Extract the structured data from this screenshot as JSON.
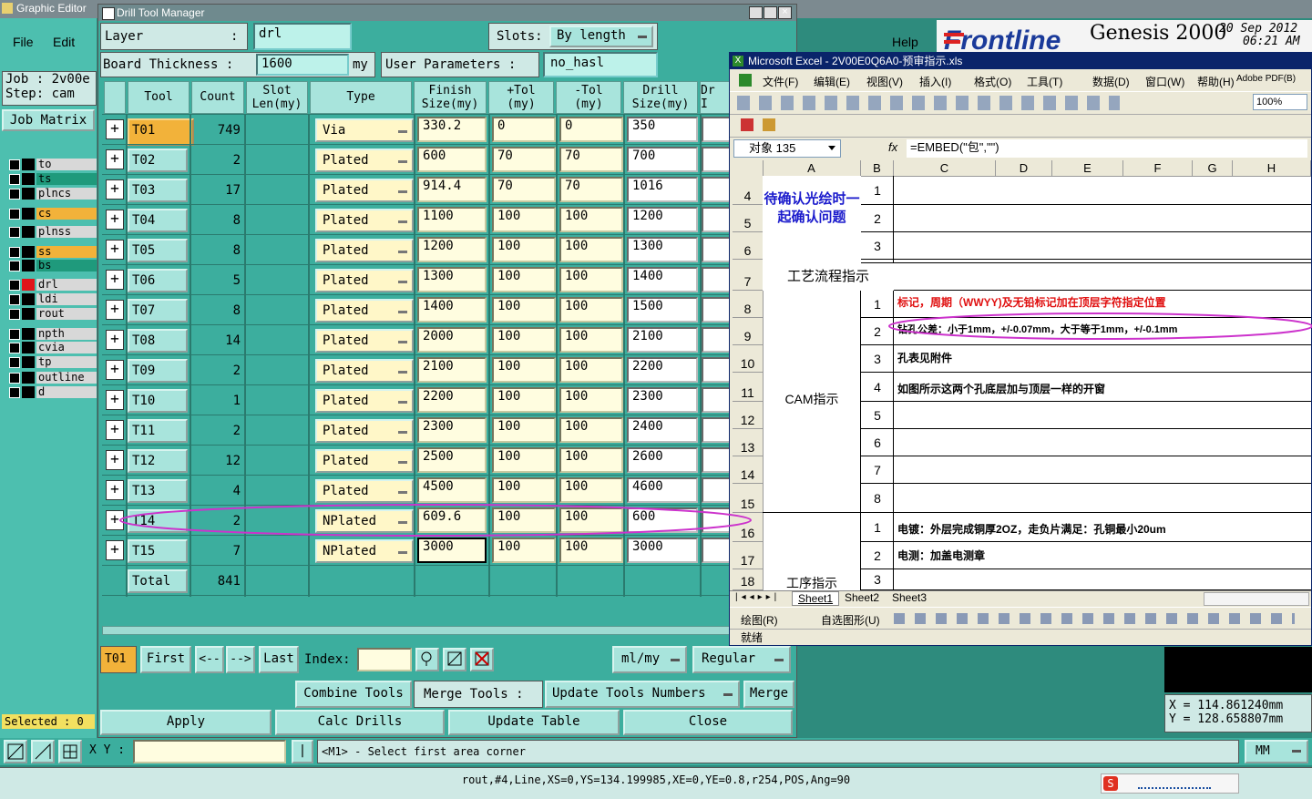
{
  "genesis": {
    "title": "Graphic Editor",
    "menu": {
      "file": "File",
      "edit": "Edit",
      "help": "Help"
    },
    "job_label": "Job : 2v00e",
    "step_label": "Step: cam",
    "job_matrix": "Job Matrix",
    "layers": [
      "to",
      "ts",
      "plncs",
      "cs",
      "plnss",
      "ss",
      "bs",
      "drl",
      "ldi",
      "rout",
      "npth",
      "cvia",
      "tp",
      "outline",
      "d"
    ],
    "layer_colors": {
      "ts": "#1f9a7c",
      "cs": "#f2b23a",
      "ss": "#f2b23a",
      "bs": "#1f9a7c",
      "default": "#d8d8d8"
    },
    "selected": "Selected : 0",
    "brand": "Frontline",
    "product": "Genesis 2000",
    "date": "20 Sep 2012",
    "time": "06:21 AM",
    "coords": {
      "x": "X  =  114.861240mm",
      "y": "Y  =  128.658807mm"
    },
    "xy_label": "X Y :",
    "prompt": "<M1> - Select first area corner",
    "units": "MM",
    "status_line": "rout,#4,Line,XS=0,YS=134.199985,XE=0,YE=0.8,r254,POS,Ang=90"
  },
  "dtm": {
    "title": "Drill Tool Manager",
    "layer_label": "Layer",
    "layer_colon": ":",
    "layer_value": "drl",
    "slots_label": "Slots:",
    "slots_value": "By length",
    "thickness_label": "Board Thickness :",
    "thickness_value": "1600",
    "thickness_unit": "my",
    "user_params_label": "User Parameters :",
    "user_params_value": "no_hasl",
    "headers": {
      "tool": "Tool",
      "count": "Count",
      "slot": "Slot\nLen(my)",
      "type": "Type",
      "finish": "Finish\nSize(my)",
      "ptol": "+Tol\n(my)",
      "mtol": "-Tol\n(my)",
      "drill": "Drill\nSize(my)",
      "dr_cut": "Dr\nI"
    },
    "rows": [
      {
        "tool": "T01",
        "count": "749",
        "type": "Via",
        "finish": "330.2",
        "ptol": "0",
        "mtol": "0",
        "drill": "350"
      },
      {
        "tool": "T02",
        "count": "2",
        "type": "Plated",
        "finish": "600",
        "ptol": "70",
        "mtol": "70",
        "drill": "700"
      },
      {
        "tool": "T03",
        "count": "17",
        "type": "Plated",
        "finish": "914.4",
        "ptol": "70",
        "mtol": "70",
        "drill": "1016"
      },
      {
        "tool": "T04",
        "count": "8",
        "type": "Plated",
        "finish": "1100",
        "ptol": "100",
        "mtol": "100",
        "drill": "1200"
      },
      {
        "tool": "T05",
        "count": "8",
        "type": "Plated",
        "finish": "1200",
        "ptol": "100",
        "mtol": "100",
        "drill": "1300"
      },
      {
        "tool": "T06",
        "count": "5",
        "type": "Plated",
        "finish": "1300",
        "ptol": "100",
        "mtol": "100",
        "drill": "1400"
      },
      {
        "tool": "T07",
        "count": "8",
        "type": "Plated",
        "finish": "1400",
        "ptol": "100",
        "mtol": "100",
        "drill": "1500"
      },
      {
        "tool": "T08",
        "count": "14",
        "type": "Plated",
        "finish": "2000",
        "ptol": "100",
        "mtol": "100",
        "drill": "2100"
      },
      {
        "tool": "T09",
        "count": "2",
        "type": "Plated",
        "finish": "2100",
        "ptol": "100",
        "mtol": "100",
        "drill": "2200"
      },
      {
        "tool": "T10",
        "count": "1",
        "type": "Plated",
        "finish": "2200",
        "ptol": "100",
        "mtol": "100",
        "drill": "2300"
      },
      {
        "tool": "T11",
        "count": "2",
        "type": "Plated",
        "finish": "2300",
        "ptol": "100",
        "mtol": "100",
        "drill": "2400"
      },
      {
        "tool": "T12",
        "count": "12",
        "type": "Plated",
        "finish": "2500",
        "ptol": "100",
        "mtol": "100",
        "drill": "2600"
      },
      {
        "tool": "T13",
        "count": "4",
        "type": "Plated",
        "finish": "4500",
        "ptol": "100",
        "mtol": "100",
        "drill": "4600"
      },
      {
        "tool": "T14",
        "count": "2",
        "type": "NPlated",
        "finish": "609.6",
        "ptol": "100",
        "mtol": "100",
        "drill": "600"
      },
      {
        "tool": "T15",
        "count": "7",
        "type": "NPlated",
        "finish": "3000",
        "ptol": "100",
        "mtol": "100",
        "drill": "3000"
      }
    ],
    "total_label": "Total",
    "total_value": "841",
    "current_tool": "T01",
    "nav": {
      "first": "First",
      "prev": "<--",
      "next": "-->",
      "last": "Last",
      "index": "Index:"
    },
    "unit_select": "ml/my",
    "mode_select": "Regular",
    "combine": "Combine Tools",
    "merge_tools": "Merge Tools :",
    "update_numbers": "Update Tools Numbers",
    "merge": "Merge",
    "apply": "Apply",
    "calc": "Calc Drills",
    "update_table": "Update Table",
    "close": "Close"
  },
  "excel": {
    "title": "Microsoft Excel - 2V00E0Q6A0-预审指示.xls",
    "menu": [
      "文件(F)",
      "编辑(E)",
      "视图(V)",
      "插入(I)",
      "格式(O)",
      "工具(T)",
      "数据(D)",
      "窗口(W)",
      "帮助(H)",
      "Adobe PDF(B)"
    ],
    "zoom": "100%",
    "name_box": "对象 135",
    "fx": "fx",
    "formula": "=EMBED(\"包\",\"\")",
    "columns": [
      "A",
      "B",
      "C",
      "D",
      "E",
      "F",
      "G",
      "H"
    ],
    "rows": [
      "4",
      "5",
      "6",
      "7",
      "8",
      "9",
      "10",
      "11",
      "12",
      "13",
      "14",
      "15",
      "16",
      "17",
      "18"
    ],
    "cells": {
      "a4": "待确认光绘时一起确认问题",
      "b4": "1",
      "b5": "2",
      "b6": "3",
      "a7": "工艺流程指示",
      "b8": "1",
      "c8": "标记，周期（WWYY)及无铅标记加在顶层字符指定位置",
      "b9": "2",
      "c9": "钻孔公差：小于1mm，+/-0.07mm，大于等于1mm，+/-0.1mm",
      "b10": "3",
      "c10": "孔表见附件",
      "a11": "CAM指示",
      "b11": "4",
      "c11": "如图所示这两个孔底层加与顶层一样的开窗",
      "b12": "5",
      "b13": "6",
      "b14": "7",
      "b15": "8",
      "b16": "1",
      "c16": "电镀：外层完成铜厚2OZ，走负片满足：孔铜最小20um",
      "b17": "2",
      "c17": "电测：加盖电测章",
      "a18": "工序指示",
      "b18": "3"
    },
    "sheets": [
      "Sheet1",
      "Sheet2",
      "Sheet3"
    ],
    "draw_label": "绘图(R)",
    "autoshape_label": "自选图形(U)",
    "status": "就绪"
  },
  "colors": {
    "annotation_ellipse": "#cc33cc"
  }
}
